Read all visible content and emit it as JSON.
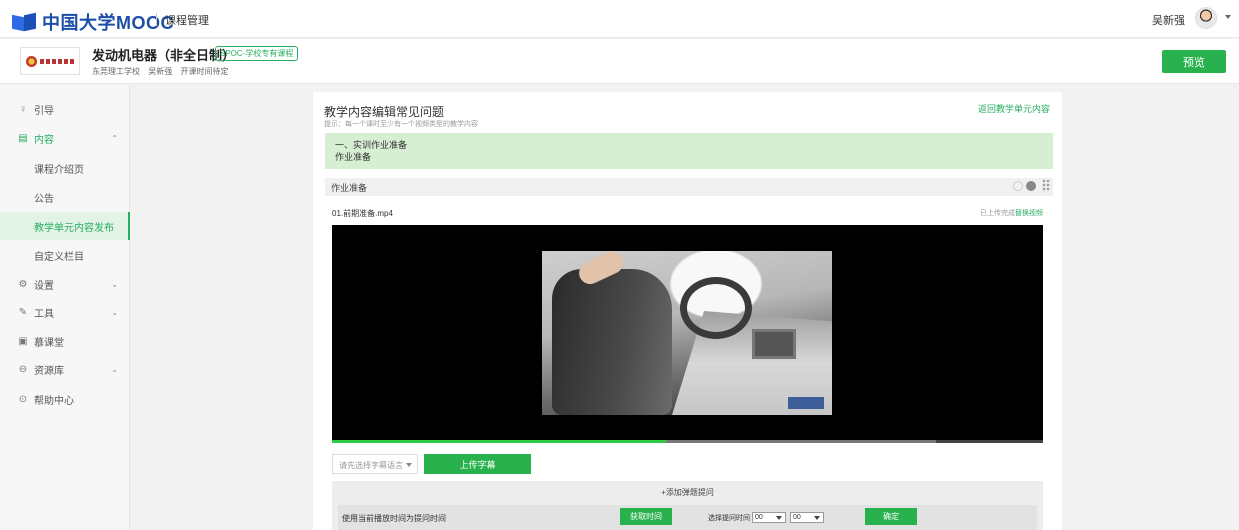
{
  "topbar": {
    "brand": "中国大学MOOC",
    "section": "课程管理",
    "user_name": "吴新强"
  },
  "course": {
    "name": "发动机电器（非全日制）",
    "badge": "SPOC-学校专有课程",
    "school": "东莞理工学校",
    "teacher": "吴新强",
    "schedule": "开课时间待定",
    "preview_label": "预览"
  },
  "sidebar": {
    "items": [
      {
        "label": "引导",
        "icon": "lightbulb-icon"
      },
      {
        "label": "内容",
        "icon": "document-icon"
      },
      {
        "label": "课程介绍页"
      },
      {
        "label": "公告"
      },
      {
        "label": "教学单元内容发布"
      },
      {
        "label": "自定义栏目"
      },
      {
        "label": "设置",
        "icon": "gear-icon"
      },
      {
        "label": "工具",
        "icon": "wrench-icon"
      },
      {
        "label": "慕课堂",
        "icon": "classroom-icon"
      },
      {
        "label": "资源库",
        "icon": "database-icon"
      },
      {
        "label": "帮助中心",
        "icon": "help-icon"
      }
    ],
    "active_index": 4
  },
  "main": {
    "title": "教学内容编辑常见问题",
    "hint": "提示：每一个课时至少有一个视频类型的教学内容",
    "back_link": "返回教学单元内容",
    "unit": {
      "line1": "一、实训作业准备",
      "line2": "作业准备"
    },
    "section_title": "作业准备",
    "file": {
      "name": "01.前期准备.mp4",
      "status": "已上传完成",
      "replace_label": "替换视频"
    },
    "video": {
      "played_fraction": 0.47,
      "buffered_fraction": 0.85
    },
    "subtitle": {
      "select_placeholder": "请先选择字幕语言",
      "upload_label": "上传字幕"
    },
    "question": {
      "add_label": "+添加弹题提问",
      "use_current_label": "使用当前播放时间为提问时间",
      "get_time_label": "获取时间",
      "pick_label": "选择提问时间",
      "minute_value": "00",
      "second_value": "00",
      "confirm_label": "确定"
    }
  },
  "colors": {
    "accent": "#28b14c",
    "brand_blue": "#1e4ea8",
    "unit_bg": "#d6efd3"
  }
}
